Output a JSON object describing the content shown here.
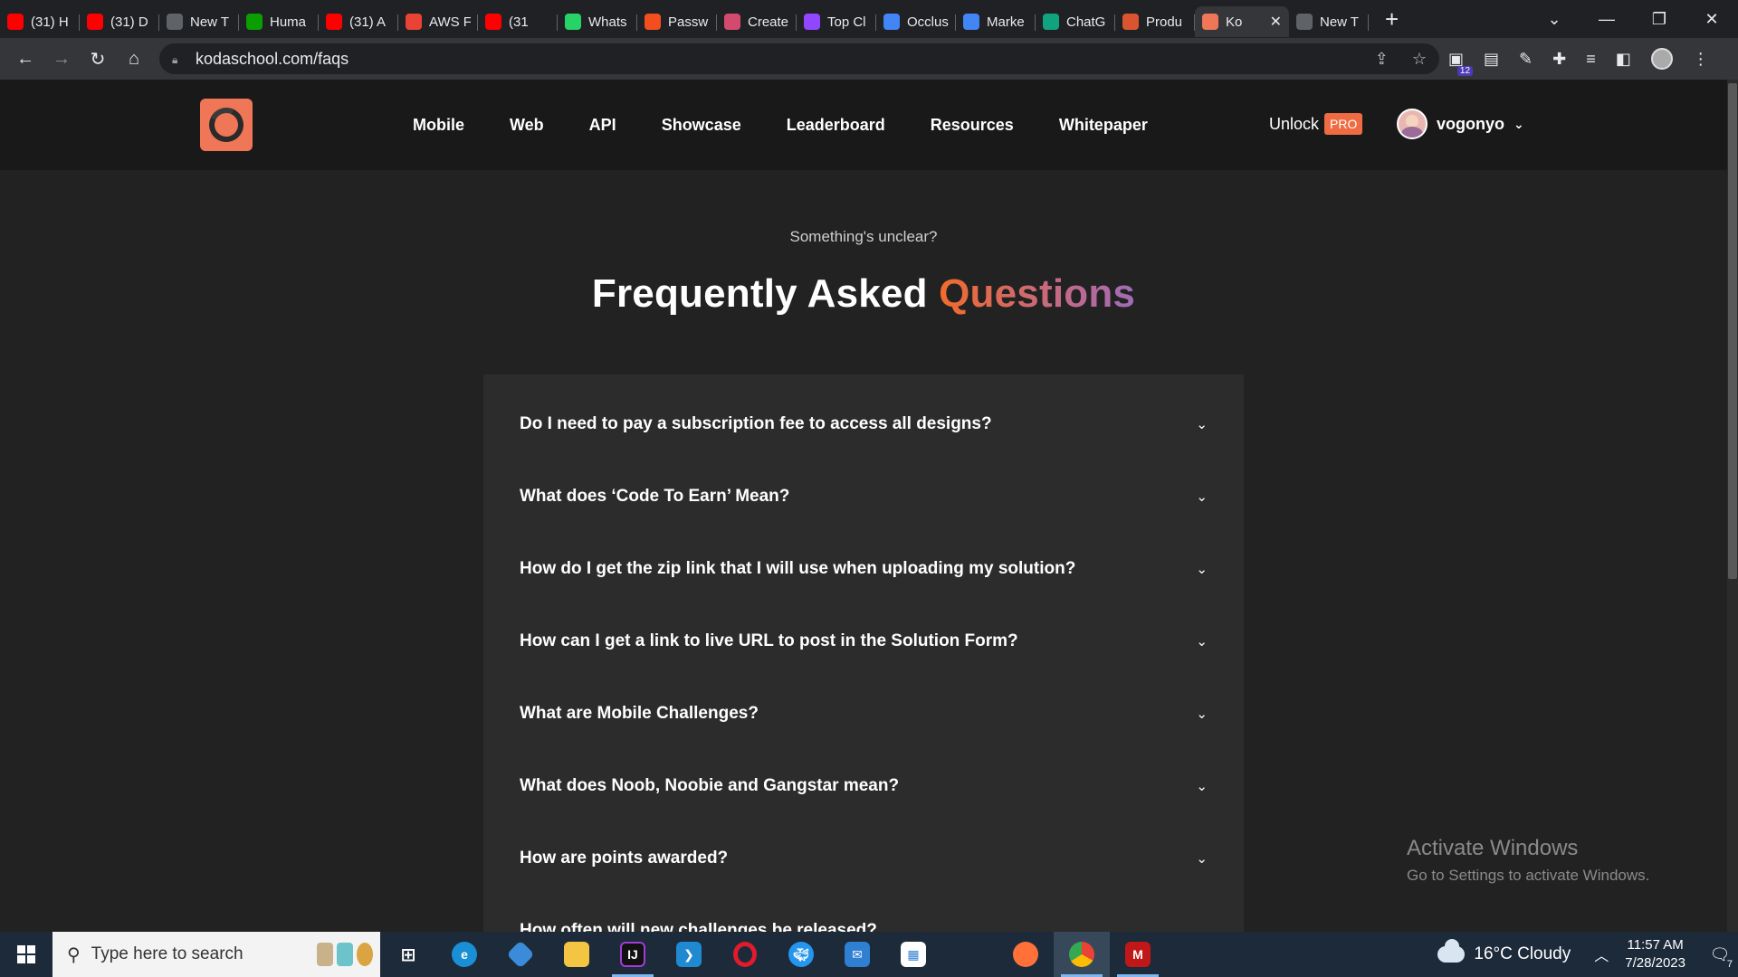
{
  "browser": {
    "tabs": [
      {
        "title": "(31) H",
        "icon": "youtube-icon",
        "color": "#ff0000"
      },
      {
        "title": "(31) D",
        "icon": "youtube-icon",
        "color": "#ff0000"
      },
      {
        "title": "New T",
        "icon": "chrome-icon",
        "color": "#5f6368"
      },
      {
        "title": "Huma",
        "icon": "techcrunch-icon",
        "color": "#0a9e01"
      },
      {
        "title": "(31) A",
        "icon": "youtube-icon",
        "color": "#ff0000"
      },
      {
        "title": "AWS F",
        "icon": "gmail-icon",
        "color": "#ea4335"
      },
      {
        "title": "(31",
        "icon": "youtube-icon",
        "color": "#ff0000"
      },
      {
        "title": "Whats",
        "icon": "whatsapp-icon",
        "color": "#25d366"
      },
      {
        "title": "Passw",
        "icon": "figma-icon",
        "color": "#f24e1e"
      },
      {
        "title": "Create",
        "icon": "create-icon",
        "color": "#d34a6e"
      },
      {
        "title": "Top Cl",
        "icon": "twitch-icon",
        "color": "#9146ff"
      },
      {
        "title": "Occlus",
        "icon": "docs-icon",
        "color": "#4285f4"
      },
      {
        "title": "Marke",
        "icon": "docs-icon",
        "color": "#4285f4"
      },
      {
        "title": "ChatG",
        "icon": "chatgpt-icon",
        "color": "#10a37f"
      },
      {
        "title": "Produ",
        "icon": "producthunt-icon",
        "color": "#da552f"
      },
      {
        "title": "Ko",
        "icon": "kodaschool-icon",
        "color": "#ef7656",
        "active": true
      },
      {
        "title": "New T",
        "icon": "chrome-icon",
        "color": "#5f6368"
      }
    ],
    "url": "kodaschool.com/faqs"
  },
  "header": {
    "nav": [
      "Mobile",
      "Web",
      "API",
      "Showcase",
      "Leaderboard",
      "Resources",
      "Whitepaper"
    ],
    "unlock_label": "Unlock",
    "pro_label": "PRO",
    "username": "vogonyo"
  },
  "faq": {
    "eyebrow": "Something's unclear?",
    "title_main": "Frequently Asked",
    "title_accent": "Questions",
    "questions": [
      "Do I need to pay a subscription fee to access all designs?",
      "What does ‘Code To Earn’ Mean?",
      "How do I get the zip link that I will use when uploading my solution?",
      "How can I get a link to live URL to post in the Solution Form?",
      "What are Mobile Challenges?",
      "What does Noob, Noobie and Gangstar mean?",
      "How are points awarded?",
      "How often will new challenges be released?"
    ]
  },
  "watermark": {
    "line1": "Activate Windows",
    "line2": "Go to Settings to activate Windows."
  },
  "taskbar": {
    "search_placeholder": "Type here to search",
    "weather": "16°C  Cloudy",
    "time": "11:57 AM",
    "date": "7/28/2023",
    "notification_count": "7"
  },
  "colors": {
    "accent_orange": "#f26b2a",
    "accent_purple": "#a16bb6",
    "logo": "#ef7656",
    "pro_badge": "#ef6c43"
  }
}
